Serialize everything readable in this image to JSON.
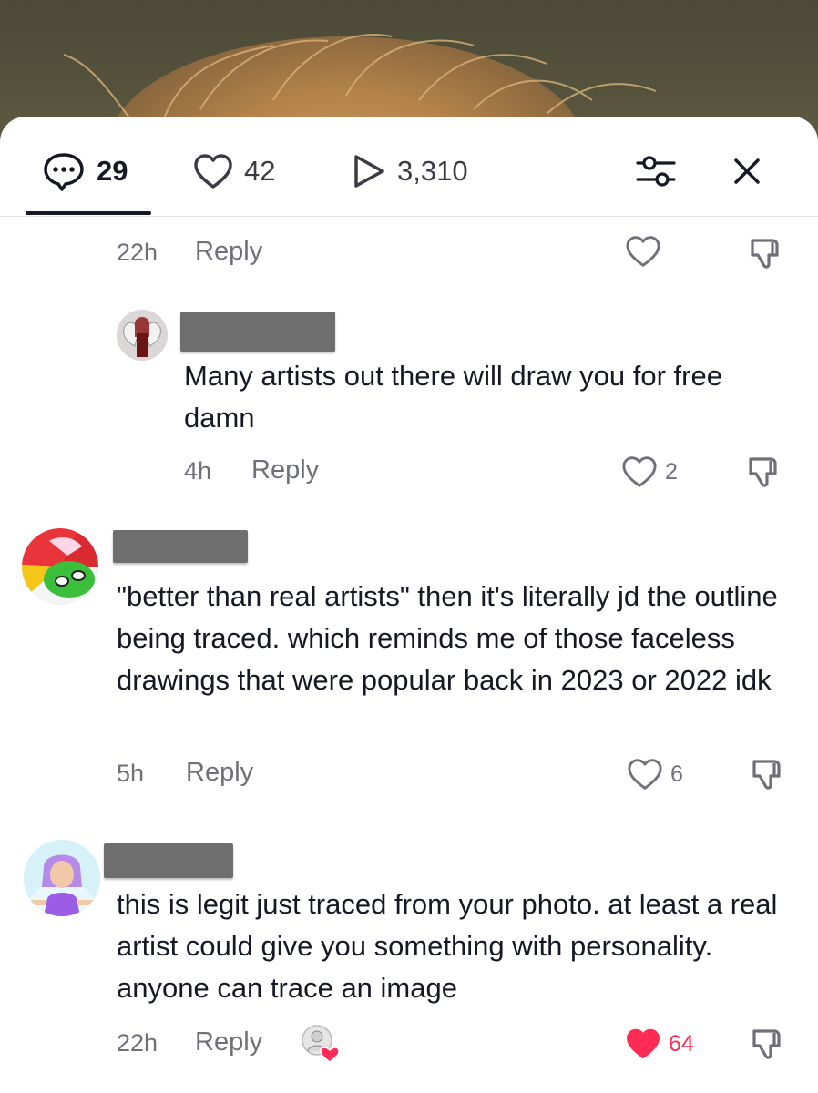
{
  "header": {
    "comments_count": "29",
    "likes_count": "42",
    "plays_count": "3,310",
    "icons": [
      "comment-icon",
      "heart-icon",
      "play-icon",
      "filter-icon",
      "close-icon"
    ]
  },
  "comments": [
    {
      "time": "22h",
      "reply_label": "Reply",
      "likes": ""
    },
    {
      "text": "Many artists out there will draw you for free damn",
      "time": "4h",
      "reply_label": "Reply",
      "likes": "2"
    },
    {
      "text": "\"better than real artists\" then it's literally jd the outline being traced. which reminds me of those faceless drawings that were popular back in 2023 or 2022 idk",
      "time": "5h",
      "reply_label": "Reply",
      "likes": "6"
    },
    {
      "text": "this is legit just traced from your photo. at least a real artist could give you something with personality. anyone can trace an image",
      "time": "22h",
      "reply_label": "Reply",
      "likes": "64",
      "liked": true
    }
  ],
  "colors": {
    "text": "#161823",
    "muted": "#6f7077",
    "like_active": "#fe2c55",
    "redaction": "#6e6e6e"
  }
}
